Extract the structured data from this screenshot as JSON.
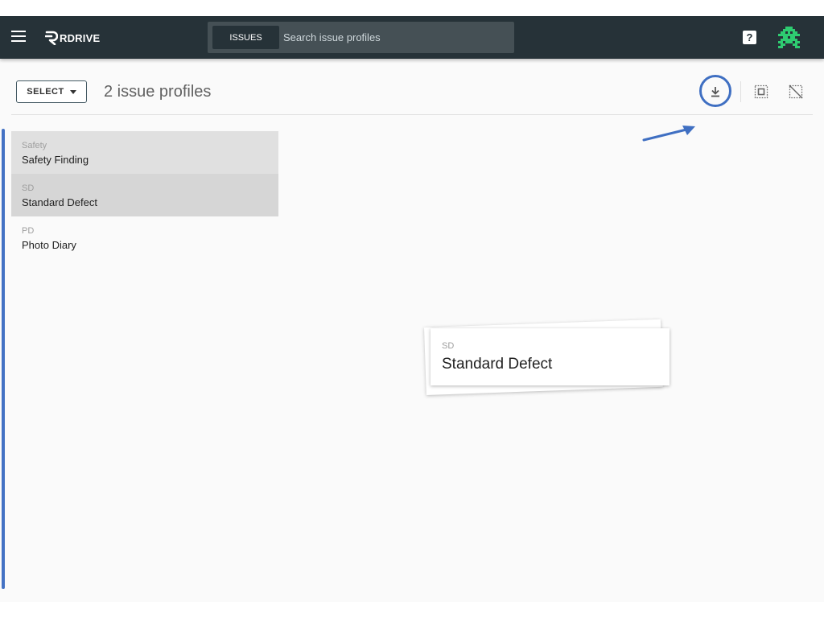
{
  "header": {
    "logo_text": "RDRIVE",
    "search_tab": "ISSUES",
    "search_placeholder": "Search issue profiles",
    "help_label": "?"
  },
  "toolbar": {
    "select_label": "SELECT",
    "count_title": "2 issue profiles"
  },
  "list": {
    "items": [
      {
        "code": "Safety",
        "name": "Safety Finding"
      },
      {
        "code": "SD",
        "name": "Standard Defect"
      },
      {
        "code": "PD",
        "name": "Photo Diary"
      }
    ]
  },
  "drag_card": {
    "code": "SD",
    "name": "Standard Defect"
  },
  "colors": {
    "topbar": "#263238",
    "accent": "#4472c4",
    "avatar": "#2ecc71"
  },
  "icons": [
    "menu-icon",
    "logo-icon",
    "help-icon",
    "avatar-icon",
    "download-icon",
    "select-all-icon",
    "deselect-all-icon",
    "caret-down-icon"
  ]
}
